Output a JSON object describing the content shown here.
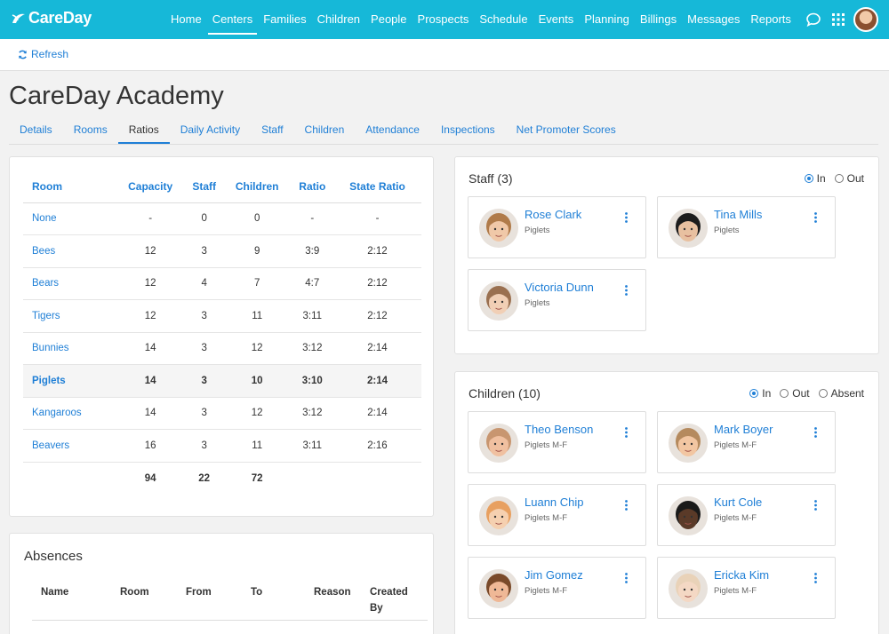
{
  "brand": {
    "logo_text": "CareDay",
    "color": "#16b8d8",
    "link": "#1f7fd6"
  },
  "nav": [
    {
      "label": "Home",
      "active": false
    },
    {
      "label": "Centers",
      "active": true
    },
    {
      "label": "Families",
      "active": false
    },
    {
      "label": "Children",
      "active": false
    },
    {
      "label": "People",
      "active": false
    },
    {
      "label": "Prospects",
      "active": false
    },
    {
      "label": "Schedule",
      "active": false
    },
    {
      "label": "Events",
      "active": false
    },
    {
      "label": "Planning",
      "active": false
    },
    {
      "label": "Billings",
      "active": false
    },
    {
      "label": "Messages",
      "active": false
    },
    {
      "label": "Reports",
      "active": false
    }
  ],
  "toolbar": {
    "refresh_label": "Refresh"
  },
  "page": {
    "title": "CareDay Academy"
  },
  "tabs": [
    {
      "label": "Details",
      "active": false
    },
    {
      "label": "Rooms",
      "active": false
    },
    {
      "label": "Ratios",
      "active": true
    },
    {
      "label": "Daily Activity",
      "active": false
    },
    {
      "label": "Staff",
      "active": false
    },
    {
      "label": "Children",
      "active": false
    },
    {
      "label": "Attendance",
      "active": false
    },
    {
      "label": "Inspections",
      "active": false
    },
    {
      "label": "Net Promoter Scores",
      "active": false
    }
  ],
  "ratios": {
    "headers": [
      "Room",
      "Capacity",
      "Staff",
      "Children",
      "Ratio",
      "State Ratio"
    ],
    "rows": [
      {
        "room": "None",
        "capacity": "-",
        "staff": "0",
        "children": "0",
        "ratio": "-",
        "state_ratio": "-",
        "highlight": false
      },
      {
        "room": "Bees",
        "capacity": "12",
        "staff": "3",
        "children": "9",
        "ratio": "3:9",
        "state_ratio": "2:12",
        "highlight": false
      },
      {
        "room": "Bears",
        "capacity": "12",
        "staff": "4",
        "children": "7",
        "ratio": "4:7",
        "state_ratio": "2:12",
        "highlight": false
      },
      {
        "room": "Tigers",
        "capacity": "12",
        "staff": "3",
        "children": "11",
        "ratio": "3:11",
        "state_ratio": "2:12",
        "highlight": false
      },
      {
        "room": "Bunnies",
        "capacity": "14",
        "staff": "3",
        "children": "12",
        "ratio": "3:12",
        "state_ratio": "2:14",
        "highlight": false
      },
      {
        "room": "Piglets",
        "capacity": "14",
        "staff": "3",
        "children": "10",
        "ratio": "3:10",
        "state_ratio": "2:14",
        "highlight": true
      },
      {
        "room": "Kangaroos",
        "capacity": "14",
        "staff": "3",
        "children": "12",
        "ratio": "3:12",
        "state_ratio": "2:14",
        "highlight": false
      },
      {
        "room": "Beavers",
        "capacity": "16",
        "staff": "3",
        "children": "11",
        "ratio": "3:11",
        "state_ratio": "2:16",
        "highlight": false
      }
    ],
    "totals": {
      "capacity": "94",
      "staff": "22",
      "children": "72"
    }
  },
  "absences": {
    "title": "Absences",
    "headers": {
      "name": "Name",
      "room": "Room",
      "from": "From",
      "to": "To",
      "reason": "Reason",
      "created_by": "Created By"
    }
  },
  "staff_section": {
    "title": "Staff (3)",
    "filters": [
      {
        "label": "In",
        "checked": true
      },
      {
        "label": "Out",
        "checked": false
      }
    ],
    "people": [
      {
        "name": "Rose Clark",
        "room": "Piglets",
        "skin": "#f0c8a8",
        "hair": "#b07b4a"
      },
      {
        "name": "Tina Mills",
        "room": "Piglets",
        "skin": "#e8c0a0",
        "hair": "#1c1c1c"
      },
      {
        "name": "Victoria Dunn",
        "room": "Piglets",
        "skin": "#f1cfb5",
        "hair": "#9a7050"
      }
    ]
  },
  "children_section": {
    "title": "Children (10)",
    "filters": [
      {
        "label": "In",
        "checked": true
      },
      {
        "label": "Out",
        "checked": false
      },
      {
        "label": "Absent",
        "checked": false
      }
    ],
    "people": [
      {
        "name": "Theo Benson",
        "room": "Piglets M-F",
        "skin": "#f0c0a0",
        "hair": "#c89670"
      },
      {
        "name": "Mark Boyer",
        "room": "Piglets M-F",
        "skin": "#f2c6a2",
        "hair": "#b58a5e"
      },
      {
        "name": "Luann Chip",
        "room": "Piglets M-F",
        "skin": "#f5d0b0",
        "hair": "#e8a060"
      },
      {
        "name": "Kurt Cole",
        "room": "Piglets M-F",
        "skin": "#5a3a28",
        "hair": "#1a1a1a"
      },
      {
        "name": "Jim Gomez",
        "room": "Piglets M-F",
        "skin": "#efb896",
        "hair": "#7a4a2a"
      },
      {
        "name": "Ericka Kim",
        "room": "Piglets M-F",
        "skin": "#f4d8c4",
        "hair": "#e9d2b8"
      }
    ]
  }
}
